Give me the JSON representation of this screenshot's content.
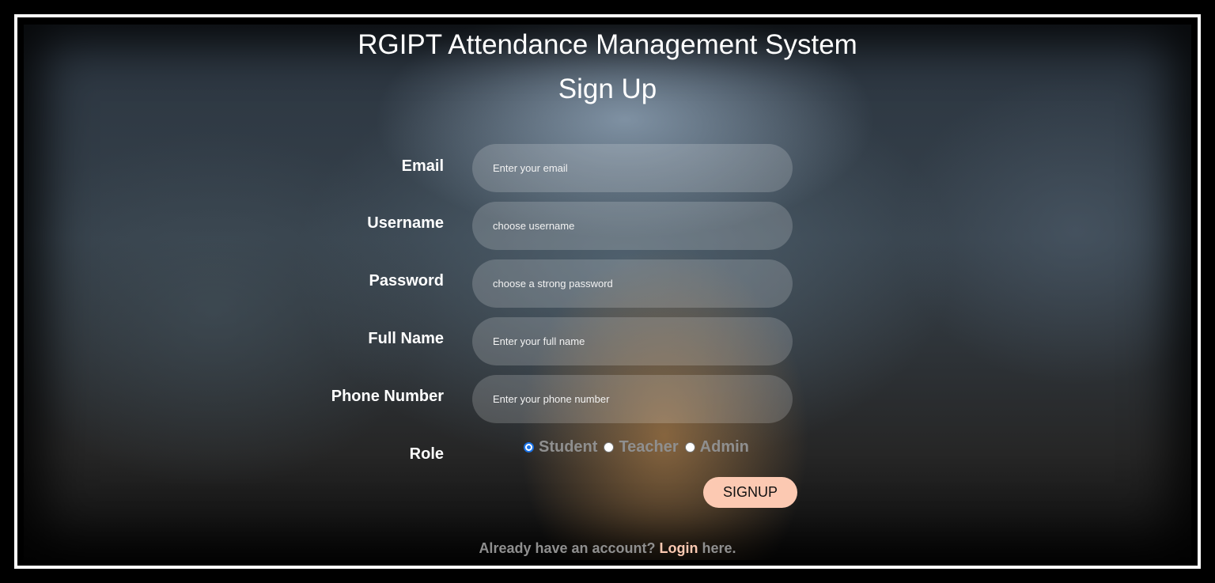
{
  "header": {
    "title": "RGIPT Attendance Management System",
    "subtitle": "Sign Up"
  },
  "form": {
    "fields": [
      {
        "label": "Email",
        "placeholder": "Enter your email",
        "value": ""
      },
      {
        "label": "Username",
        "placeholder": "choose username",
        "value": ""
      },
      {
        "label": "Password",
        "placeholder": "choose a strong password",
        "value": ""
      },
      {
        "label": "Full Name",
        "placeholder": "Enter your full name",
        "value": ""
      },
      {
        "label": "Phone Number",
        "placeholder": "Enter your phone number",
        "value": ""
      }
    ],
    "role": {
      "label": "Role",
      "options": [
        "Student",
        "Teacher",
        "Admin"
      ],
      "selected": "Student"
    },
    "submit_label": "SIGNUP"
  },
  "footer": {
    "prefix": "Already have an account?",
    "link_label": "Login",
    "suffix": "here."
  },
  "colors": {
    "button_bg": "#fcc9b2",
    "link": "#fcc9b2",
    "muted_text": "#8f8f8f",
    "radio_accent": "#1a73e8"
  }
}
